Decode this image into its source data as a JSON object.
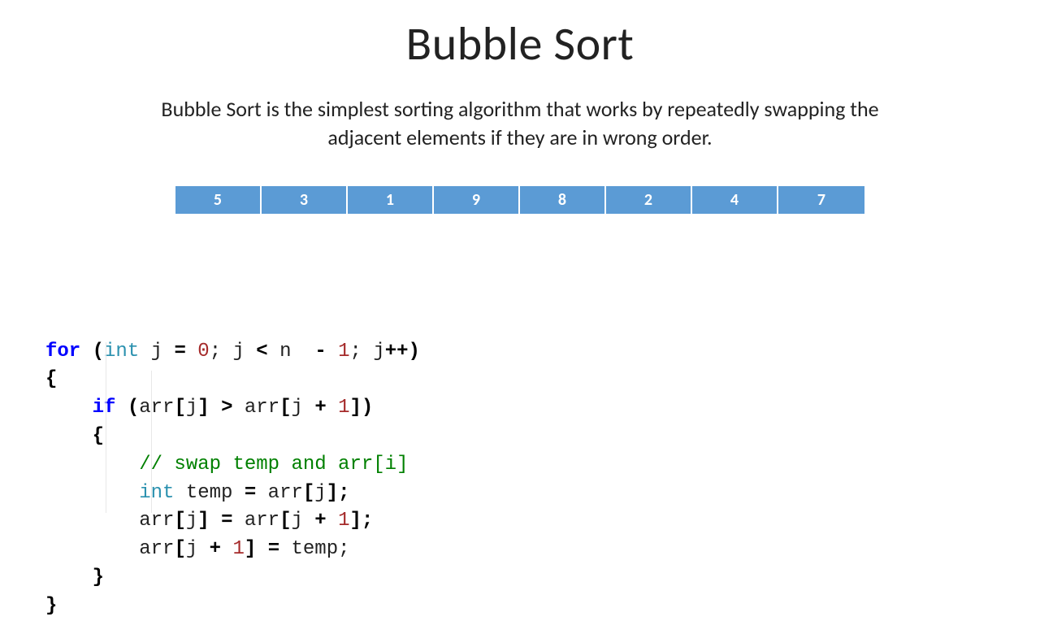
{
  "title": "Bubble Sort",
  "description": "Bubble Sort is the simplest sorting algorithm that works by repeatedly swapping the adjacent elements if they are in wrong order.",
  "array": [
    "5",
    "3",
    "1",
    "9",
    "8",
    "2",
    "4",
    "7"
  ],
  "code": {
    "tokens": [
      [
        {
          "t": "for",
          "c": "kw"
        },
        {
          "t": " ",
          "c": "pl"
        },
        {
          "t": "(",
          "c": "pun"
        },
        {
          "t": "int",
          "c": "ty"
        },
        {
          "t": " j ",
          "c": "pl"
        },
        {
          "t": "=",
          "c": "pun"
        },
        {
          "t": " ",
          "c": "pl"
        },
        {
          "t": "0",
          "c": "num"
        },
        {
          "t": "; j ",
          "c": "pl"
        },
        {
          "t": "<",
          "c": "pun"
        },
        {
          "t": " n  ",
          "c": "pl"
        },
        {
          "t": "-",
          "c": "pun"
        },
        {
          "t": " ",
          "c": "pl"
        },
        {
          "t": "1",
          "c": "num"
        },
        {
          "t": "; j",
          "c": "pl"
        },
        {
          "t": "++)",
          "c": "pun"
        }
      ],
      [
        {
          "t": "{",
          "c": "pun"
        }
      ],
      [
        {
          "t": "    ",
          "c": "pl"
        },
        {
          "t": "if",
          "c": "kw"
        },
        {
          "t": " ",
          "c": "pl"
        },
        {
          "t": "(",
          "c": "pun"
        },
        {
          "t": "arr",
          "c": "pl"
        },
        {
          "t": "[",
          "c": "pun"
        },
        {
          "t": "j",
          "c": "pl"
        },
        {
          "t": "]",
          "c": "pun"
        },
        {
          "t": " ",
          "c": "pl"
        },
        {
          "t": ">",
          "c": "pun"
        },
        {
          "t": " arr",
          "c": "pl"
        },
        {
          "t": "[",
          "c": "pun"
        },
        {
          "t": "j ",
          "c": "pl"
        },
        {
          "t": "+",
          "c": "pun"
        },
        {
          "t": " ",
          "c": "pl"
        },
        {
          "t": "1",
          "c": "num"
        },
        {
          "t": "])",
          "c": "pun"
        }
      ],
      [
        {
          "t": "    ",
          "c": "pl"
        },
        {
          "t": "{",
          "c": "pun"
        }
      ],
      [
        {
          "t": "        ",
          "c": "pl"
        },
        {
          "t": "// swap temp and arr[i]",
          "c": "cm"
        }
      ],
      [
        {
          "t": "        ",
          "c": "pl"
        },
        {
          "t": "int",
          "c": "ty"
        },
        {
          "t": " temp ",
          "c": "pl"
        },
        {
          "t": "=",
          "c": "pun"
        },
        {
          "t": " arr",
          "c": "pl"
        },
        {
          "t": "[",
          "c": "pun"
        },
        {
          "t": "j",
          "c": "pl"
        },
        {
          "t": "];",
          "c": "pun"
        }
      ],
      [
        {
          "t": "        arr",
          "c": "pl"
        },
        {
          "t": "[",
          "c": "pun"
        },
        {
          "t": "j",
          "c": "pl"
        },
        {
          "t": "]",
          "c": "pun"
        },
        {
          "t": " ",
          "c": "pl"
        },
        {
          "t": "=",
          "c": "pun"
        },
        {
          "t": " arr",
          "c": "pl"
        },
        {
          "t": "[",
          "c": "pun"
        },
        {
          "t": "j ",
          "c": "pl"
        },
        {
          "t": "+",
          "c": "pun"
        },
        {
          "t": " ",
          "c": "pl"
        },
        {
          "t": "1",
          "c": "num"
        },
        {
          "t": "];",
          "c": "pun"
        }
      ],
      [
        {
          "t": "        arr",
          "c": "pl"
        },
        {
          "t": "[",
          "c": "pun"
        },
        {
          "t": "j ",
          "c": "pl"
        },
        {
          "t": "+",
          "c": "pun"
        },
        {
          "t": " ",
          "c": "pl"
        },
        {
          "t": "1",
          "c": "num"
        },
        {
          "t": "]",
          "c": "pun"
        },
        {
          "t": " ",
          "c": "pl"
        },
        {
          "t": "=",
          "c": "pun"
        },
        {
          "t": " temp;",
          "c": "pl"
        }
      ],
      [
        {
          "t": "    ",
          "c": "pl"
        },
        {
          "t": "}",
          "c": "pun"
        }
      ],
      [
        {
          "t": "}",
          "c": "pun"
        }
      ]
    ]
  }
}
